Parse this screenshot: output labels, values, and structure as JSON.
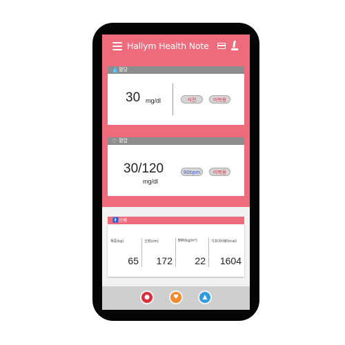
{
  "header": {
    "title": "Hallym Health Note",
    "menu_icon": "hamburger-icon",
    "calendar_icon": "calendar-icon",
    "profile_icon": "person-icon"
  },
  "blood_sugar": {
    "label": "혈당",
    "icon": "drop-icon",
    "value": "30",
    "unit": "mg/dl",
    "tag1": "식전",
    "tag2": "미복용"
  },
  "blood_pressure": {
    "label": "혈압",
    "icon": "heart-pulse-icon",
    "value": "30/120",
    "unit": "mg/dl",
    "pulse_tag": "90bpm",
    "tag2": "미복용"
  },
  "body": {
    "label": "신체",
    "icon": "person-icon",
    "stats": [
      {
        "label": "체중(kg)",
        "value": "65"
      },
      {
        "label": "신장(cm)",
        "value": "172"
      },
      {
        "label": "BMI(kg/m²)",
        "value": "22"
      },
      {
        "label": "기초대사량(kcal)",
        "value": "1604"
      }
    ]
  },
  "bottom_nav": [
    {
      "name": "blood-sugar-nav",
      "icon": "drop-icon",
      "color": "#d8303f"
    },
    {
      "name": "blood-pressure-nav",
      "icon": "heart-icon",
      "color": "#f08a2c"
    },
    {
      "name": "body-nav",
      "icon": "person-icon",
      "color": "#2f9be0"
    }
  ],
  "colors": {
    "accent": "#ee6b7c",
    "card_header": "#8d8d8d"
  }
}
